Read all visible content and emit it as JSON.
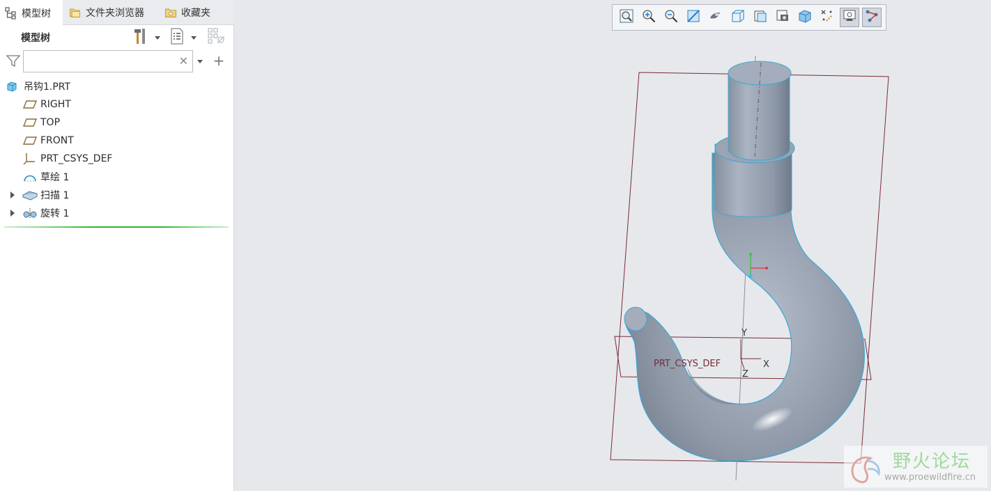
{
  "tabs": [
    {
      "label": "模型树",
      "icon": "model-tree-icon",
      "active": true
    },
    {
      "label": "文件夹浏览器",
      "icon": "folder-browser-icon",
      "active": false
    },
    {
      "label": "收藏夹",
      "icon": "favorites-icon",
      "active": false
    }
  ],
  "panel": {
    "title": "模型树",
    "search": {
      "value": "",
      "placeholder": ""
    }
  },
  "tree": {
    "root": "吊钩1.PRT",
    "items": [
      {
        "label": "RIGHT",
        "icon": "datum-plane-icon"
      },
      {
        "label": "TOP",
        "icon": "datum-plane-icon"
      },
      {
        "label": "FRONT",
        "icon": "datum-plane-icon"
      },
      {
        "label": "PRT_CSYS_DEF",
        "icon": "csys-icon"
      },
      {
        "label": "草绘 1",
        "icon": "sketch-icon"
      },
      {
        "label": "扫描 1",
        "icon": "sweep-icon",
        "expandable": true
      },
      {
        "label": "旋转 1",
        "icon": "revolve-icon",
        "expandable": true
      }
    ]
  },
  "view_toolbar": [
    "refit-icon",
    "zoom-in-icon",
    "zoom-out-icon",
    "repaint-icon",
    "display-style-icon",
    "saved-orientations-icon",
    "view-manager-icon",
    "perspective-icon",
    "section-icon",
    "datum-display-icon",
    "spin-center-icon",
    "annotation-display-icon"
  ],
  "viewport": {
    "csys_label": "PRT_CSYS_DEF",
    "axis_x": "X",
    "axis_y": "Y",
    "axis_z": "Z"
  },
  "watermark": {
    "name": "野火论坛",
    "url": "www.proewildfire.cn"
  },
  "colors": {
    "model_edge": "#3aa9d6",
    "datum_plane": "#7a2b35",
    "insert_line": "#2bb52b"
  }
}
